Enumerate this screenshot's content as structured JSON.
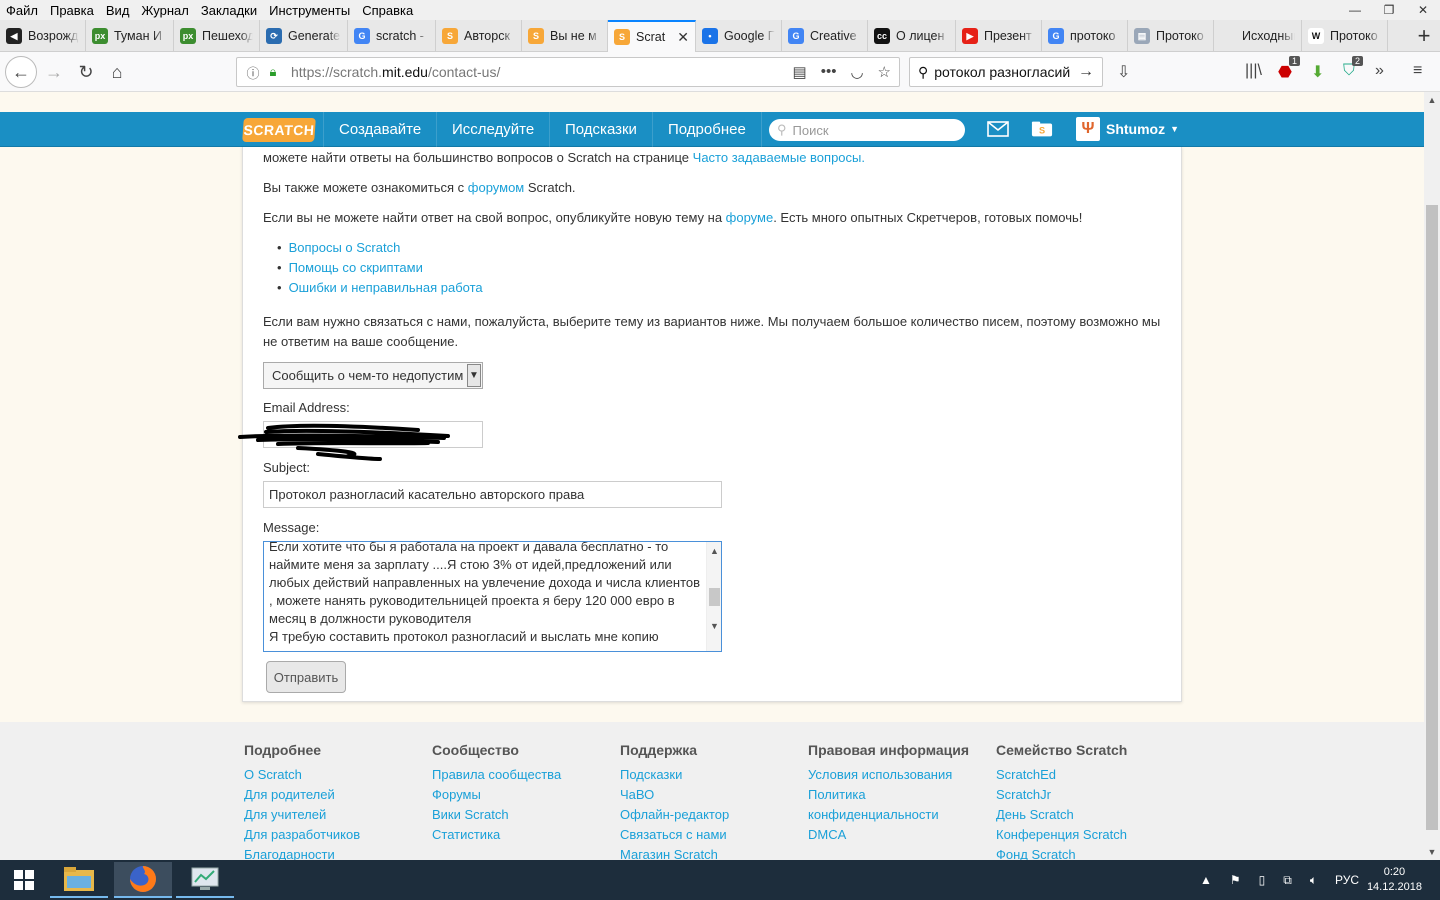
{
  "menu": [
    "Файл",
    "Правка",
    "Вид",
    "Журнал",
    "Закладки",
    "Инструменты",
    "Справка"
  ],
  "tabs": [
    {
      "label": "Возрожд",
      "fav_color": "#222",
      "fav_glyph": "◀"
    },
    {
      "label": "Туман И",
      "fav_color": "#3c8d2f",
      "fav_glyph": "px"
    },
    {
      "label": "Пешеход",
      "fav_color": "#3c8d2f",
      "fav_glyph": "px"
    },
    {
      "label": "Generate",
      "fav_color": "#2b6cb0",
      "fav_glyph": "⟳"
    },
    {
      "label": "scratch -",
      "fav_color": "#4285f4",
      "fav_glyph": "G"
    },
    {
      "label": "Авторск",
      "fav_color": "#f7a738",
      "fav_glyph": "S"
    },
    {
      "label": "Вы не м",
      "fav_color": "#f7a738",
      "fav_glyph": "S"
    },
    {
      "label": "Scrat",
      "fav_color": "#f7a738",
      "fav_glyph": "S"
    },
    {
      "label": "Google Г",
      "fav_color": "#1a73e8",
      "fav_glyph": "•"
    },
    {
      "label": "Creative",
      "fav_color": "#4285f4",
      "fav_glyph": "G"
    },
    {
      "label": "О лицен",
      "fav_color": "#111",
      "fav_glyph": "cc"
    },
    {
      "label": "Презент",
      "fav_color": "#e62117",
      "fav_glyph": "▶"
    },
    {
      "label": "протоко",
      "fav_color": "#4285f4",
      "fav_glyph": "G"
    },
    {
      "label": "Протоко",
      "fav_color": "#9aa7b8",
      "fav_glyph": "▤"
    },
    {
      "label": "Исходный к",
      "fav_color": "#e8e8e8",
      "fav_glyph": ""
    },
    {
      "label": "Протоко",
      "fav_color": "#fff",
      "fav_glyph": "W"
    }
  ],
  "active_tab_close": "✕",
  "newtab": "+",
  "nav": {
    "url_prefix": "https://scratch.",
    "url_domain": "mit.edu",
    "url_path": "/contact-us/",
    "search_value": "ротокол разногласий"
  },
  "toolbar_badges": {
    "abp": "1",
    "shield": "2"
  },
  "scratch": {
    "logo": "SCRATCH",
    "nav": [
      "Создавайте",
      "Исследуйте",
      "Подсказки",
      "Подробнее"
    ],
    "search_placeholder": "Поиск",
    "username": "Shtumoz"
  },
  "content": {
    "p1_text": "можете найти ответы на большинство вопросов о Scratch на странице ",
    "p1_link": "Часто задаваемые вопросы.",
    "p2_text": "Вы также можете ознакомиться с ",
    "p2_link": "форумом",
    "p2_after": " Scratch.",
    "p3_text": "Если вы не можете найти ответ на свой вопрос, опубликуйте новую тему на ",
    "p3_link": "форуме",
    "p3_after": ". Есть много опытных Скретчеров, готовых помочь!",
    "forum_links": [
      "Вопросы о Scratch",
      "Помощь со скриптами",
      "Ошибки и неправильная работа"
    ],
    "p4_line1": "Если вам нужно связаться с нами, пожалуйста, выберите тему из вариантов ниже. Мы получаем большое количество писем, поэтому возможно мы",
    "p4_line2": "не ответим на ваше сообщение.",
    "topic_select": "Сообщить о чем-то недопустим",
    "email_label": "Email Address:",
    "subject_label": "Subject:",
    "subject_value": "Протокол разногласий касательно авторского права",
    "message_label": "Message:",
    "message_value": "Если хотите что бы я работала на проект и давала бесплатно - то\nнаймите меня за зарплату ....Я стою 3% от идей,предложений или\nлюбых действий направленных на увлечение дохода и числа клиентов\n, можете нанять руководительницей проекта я беру 120 000 евро в\nмесяц в должности руководителя\nЯ требую составить протокол разногласий и выслать мне копию правил",
    "submit_label": "Отправить"
  },
  "footer": [
    {
      "heading": "Подробнее",
      "links": [
        "О Scratch",
        "Для родителей",
        "Для учителей",
        "Для разработчиков",
        "Благодарности"
      ]
    },
    {
      "heading": "Сообщество",
      "links": [
        "Правила сообщества",
        "Форумы",
        "Вики Scratch",
        "Статистика"
      ]
    },
    {
      "heading": "Поддержка",
      "links": [
        "Подсказки",
        "ЧаВО",
        "Офлайн-редактор",
        "Связаться с нами",
        "Магазин Scratch"
      ]
    },
    {
      "heading": "Правовая информация",
      "links": [
        "Условия использования",
        "Политика",
        "конфиденциальности",
        "DMCA"
      ]
    },
    {
      "heading": "Семейство Scratch",
      "links": [
        "ScratchEd",
        "ScratchJr",
        "День Scratch",
        "Конференция Scratch",
        "Фонд Scratch"
      ]
    }
  ],
  "taskbar": {
    "language": "РУС",
    "time": "0:20",
    "date": "14.12.2018"
  }
}
